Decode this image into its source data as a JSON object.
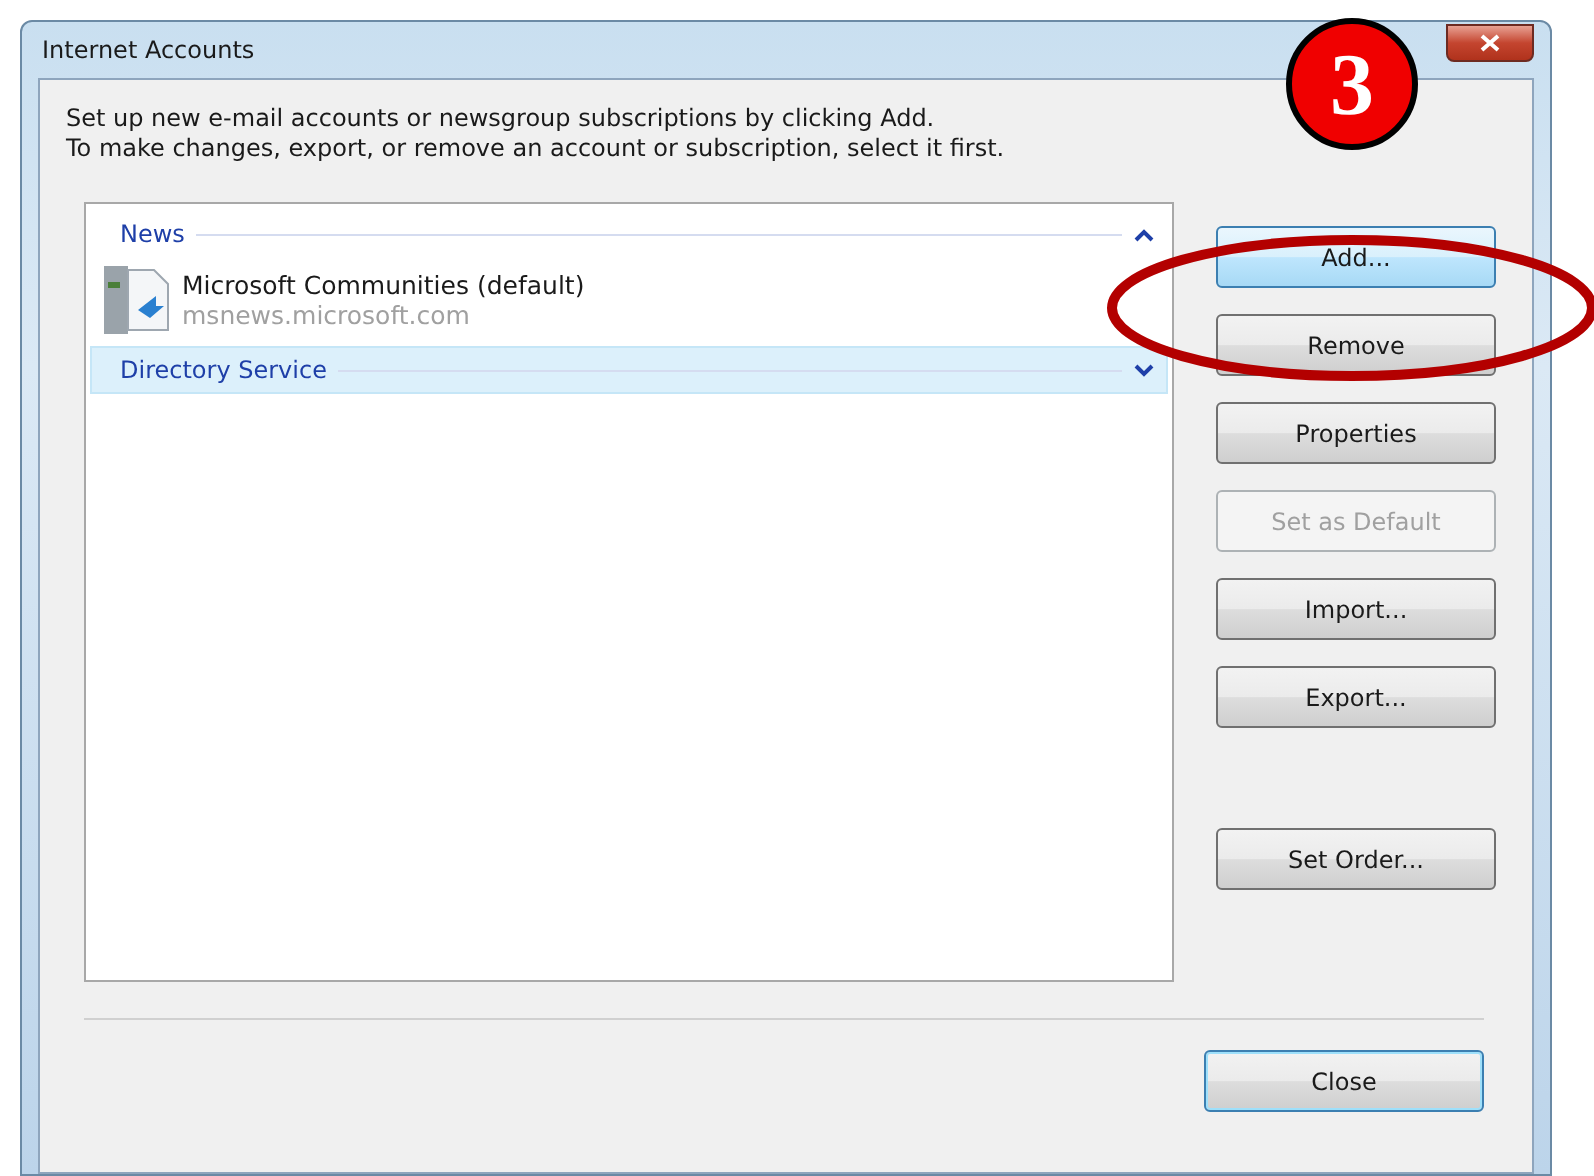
{
  "window": {
    "title": "Internet Accounts"
  },
  "instructions": [
    "Set up new e-mail accounts or newsgroup subscriptions by clicking Add.",
    "To make changes, export, or remove an account or subscription, select it first."
  ],
  "groups": [
    {
      "label": "News",
      "expanded": true,
      "selected": false,
      "accounts": [
        {
          "name": "Microsoft Communities (default)",
          "server": "msnews.microsoft.com"
        }
      ]
    },
    {
      "label": "Directory Service",
      "expanded": false,
      "selected": true
    }
  ],
  "button_groups": [
    [
      {
        "label": "Add...",
        "highlighted": true,
        "disabled": false
      },
      {
        "label": "Remove",
        "highlighted": false,
        "disabled": false
      },
      {
        "label": "Properties",
        "highlighted": false,
        "disabled": false
      },
      {
        "label": "Set as Default",
        "highlighted": false,
        "disabled": true
      },
      {
        "label": "Import...",
        "highlighted": false,
        "disabled": false
      },
      {
        "label": "Export...",
        "highlighted": false,
        "disabled": false
      }
    ],
    [
      {
        "label": "Set Order...",
        "highlighted": false,
        "disabled": false
      }
    ]
  ],
  "close_button": {
    "label": "Close"
  },
  "annotation": {
    "step": "3"
  }
}
